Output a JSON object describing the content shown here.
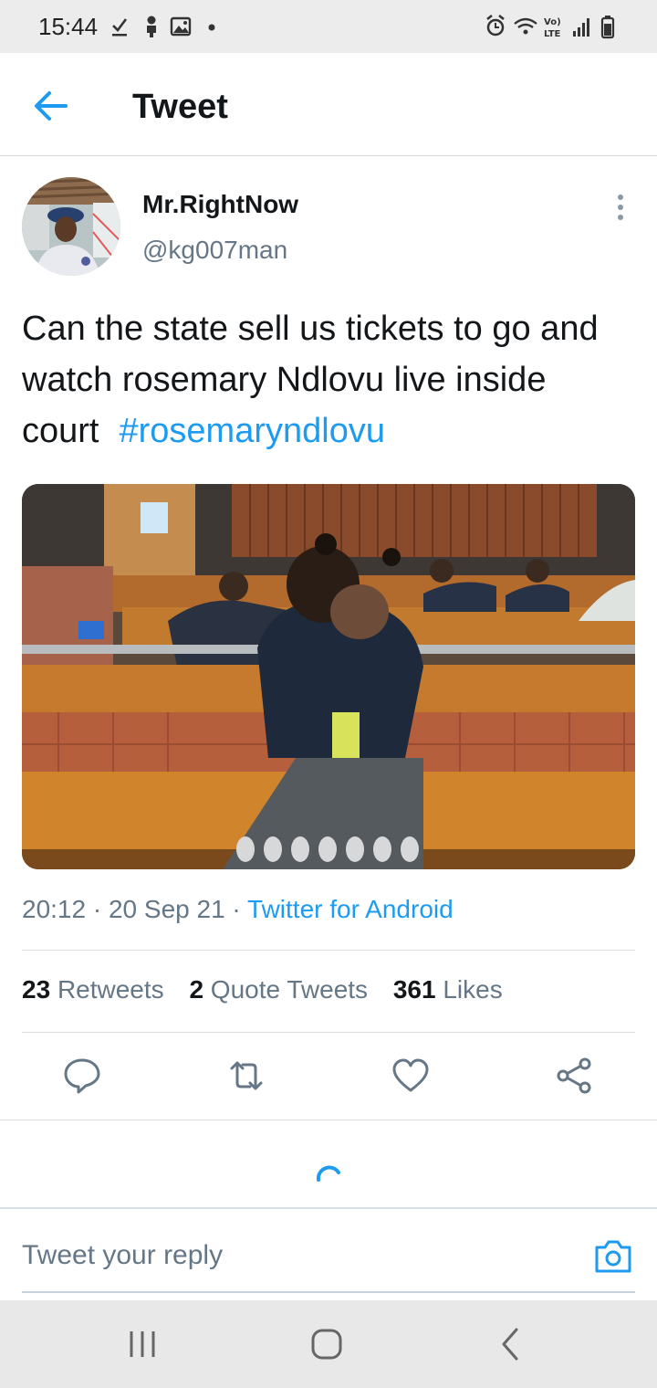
{
  "status_bar": {
    "time": "15:44"
  },
  "header": {
    "title": "Tweet"
  },
  "author": {
    "name": "Mr.RightNow",
    "handle": "@kg007man"
  },
  "tweet": {
    "text": "Can the state sell us tickets to go and watch rosemary Ndlovu live inside court",
    "hashtag": "#rosemaryndlovu",
    "time": "20:12",
    "date": "20 Sep 21",
    "separator": "·",
    "source": "Twitter for Android"
  },
  "stats": {
    "retweets_count": "23",
    "retweets_label": "Retweets",
    "quotes_count": "2",
    "quotes_label": "Quote Tweets",
    "likes_count": "361",
    "likes_label": "Likes"
  },
  "reply": {
    "placeholder": "Tweet your reply"
  },
  "icons": {
    "back": "arrow-left-icon",
    "more": "more-vertical-icon",
    "reply": "comment-icon",
    "retweet": "retweet-icon",
    "like": "heart-icon",
    "share": "share-icon",
    "camera": "camera-icon"
  },
  "colors": {
    "accent": "#1d9bf0",
    "secondary_text": "#657786",
    "primary_text": "#14171a"
  }
}
